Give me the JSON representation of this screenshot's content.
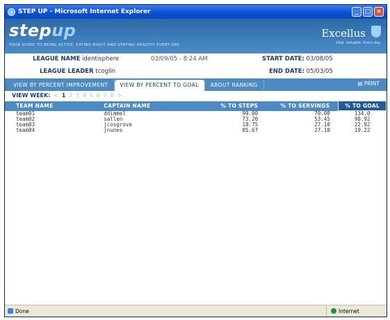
{
  "window": {
    "title": "STEP UP - Microsoft Internet Explorer"
  },
  "banner": {
    "logo_step": "step",
    "logo_up": "up",
    "tagline": "YOUR GUIDE TO BEING ACTIVE, EATING RIGHT AND STAYING HEALTHY EVERY DAY.",
    "brand": "Excellus",
    "brand_sub": "Vital. Valuable. Every day."
  },
  "info": {
    "league_name_label": "LEAGUE NAME",
    "league_name": "identisphere",
    "datetime": "03/09/05 - 8:24 AM",
    "start_date_label": "START DATE:",
    "start_date": "03/08/05",
    "league_leader_label": "LEAGUE LEADER",
    "league_leader": "tcoglin",
    "end_date_label": "END DATE:",
    "end_date": "05/03/05"
  },
  "tabs": [
    {
      "label": "VIEW BY PERCENT IMPROVEMENT"
    },
    {
      "label": "VIEW BY PERCENT TO GOAL"
    },
    {
      "label": "ABOUT RANKING"
    }
  ],
  "print_label": "PRINT",
  "week": {
    "label": "VIEW WEEK:",
    "pages": [
      "<",
      "1",
      "2",
      "3",
      "4",
      "5",
      "6",
      "7",
      "8",
      ">"
    ]
  },
  "table": {
    "headers": [
      "TEAM NAME",
      "CAPTAIN NAME",
      "% TO STEPS",
      "% TO SERVINGS",
      "% TO GOAL"
    ],
    "rows": [
      [
        "team01",
        "ddimmel",
        "99.00",
        "70.00",
        "134.0"
      ],
      [
        "team02",
        "sallen",
        "73.20",
        "53.45",
        "98.92"
      ],
      [
        "team03",
        "jcosgrove",
        "18.75",
        "27.10",
        "22.92"
      ],
      [
        "team04",
        "jnunes",
        "85.67",
        "27.10",
        "19.22"
      ]
    ]
  },
  "status": {
    "left": "Done",
    "zone": "Internet"
  }
}
